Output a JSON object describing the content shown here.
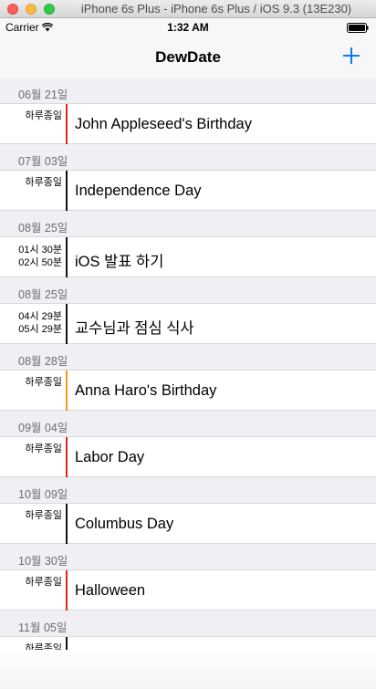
{
  "window": {
    "title": "iPhone 6s Plus - iPhone 6s Plus / iOS 9.3 (13E230)"
  },
  "status_bar": {
    "carrier": "Carrier",
    "time": "1:32 AM"
  },
  "nav": {
    "title": "DewDate"
  },
  "sections": [
    {
      "date": "06월 21일",
      "time_lines": [
        "하루종일"
      ],
      "title": "John Appleseed's Birthday",
      "color": "#e2241c"
    },
    {
      "date": "07월 03일",
      "time_lines": [
        "하루종일"
      ],
      "title": "Independence Day",
      "color": "#111111"
    },
    {
      "date": "08월 25일",
      "time_lines": [
        "01시 30분",
        "02시 50분"
      ],
      "title": "iOS 발표 하기",
      "color": "#111111"
    },
    {
      "date": "08월 25일",
      "time_lines": [
        "04시 29분",
        "05시 29분"
      ],
      "title": "교수님과 점심 식사",
      "color": "#111111"
    },
    {
      "date": "08월 28일",
      "time_lines": [
        "하루종일"
      ],
      "title": "Anna Haro's Birthday",
      "color": "#f29a12"
    },
    {
      "date": "09월 04일",
      "time_lines": [
        "하루종일"
      ],
      "title": "Labor Day",
      "color": "#e2241c"
    },
    {
      "date": "10월 09일",
      "time_lines": [
        "하루종일"
      ],
      "title": "Columbus Day",
      "color": "#111111"
    },
    {
      "date": "10월 30일",
      "time_lines": [
        "하루종일"
      ],
      "title": "Halloween",
      "color": "#e2241c"
    },
    {
      "date": "11월 05일",
      "time_lines": [
        "하루종일"
      ],
      "title": "",
      "color": "#111111"
    }
  ]
}
